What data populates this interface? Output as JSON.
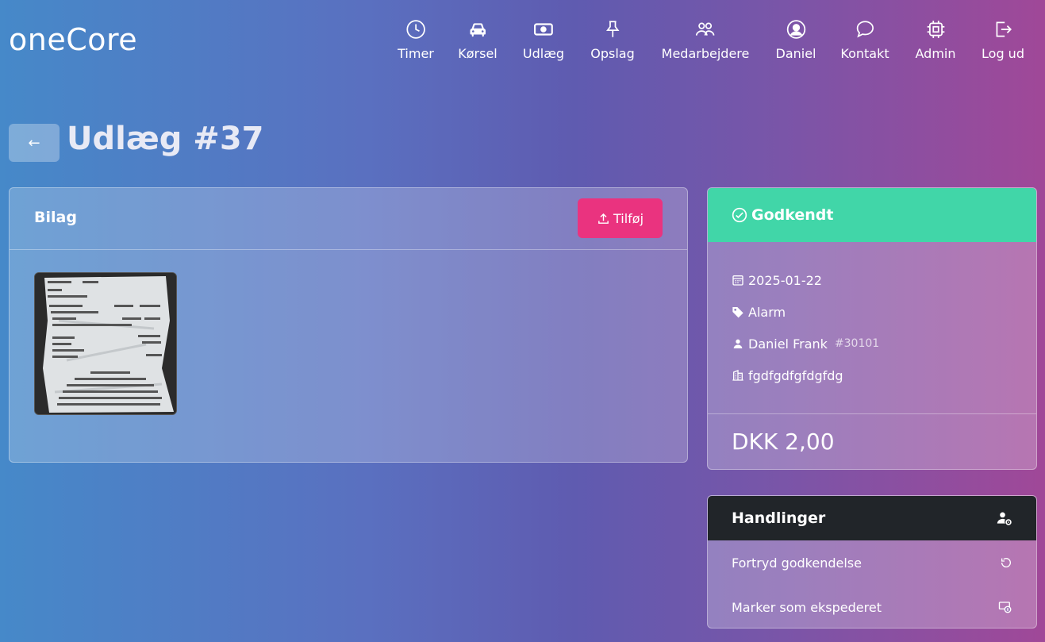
{
  "app": {
    "logo": "oneCore"
  },
  "nav": [
    {
      "label": "Timer",
      "icon": "clock-icon"
    },
    {
      "label": "Kørsel",
      "icon": "car-icon"
    },
    {
      "label": "Udlæg",
      "icon": "cash-icon"
    },
    {
      "label": "Opslag",
      "icon": "pin-icon"
    },
    {
      "label": "Medarbejdere",
      "icon": "people-icon"
    },
    {
      "label": "Daniel",
      "icon": "user-circle-icon"
    },
    {
      "label": "Kontakt",
      "icon": "chat-icon"
    },
    {
      "label": "Admin",
      "icon": "cpu-icon"
    },
    {
      "label": "Log ud",
      "icon": "logout-icon"
    }
  ],
  "page": {
    "back_label": "←",
    "title": "Udlæg #37"
  },
  "bilag": {
    "title": "Bilag",
    "add_label": "Tilføj"
  },
  "status": {
    "label": "Godkendt",
    "color": "#41d6a8",
    "date": "2025-01-22",
    "category": "Alarm",
    "employee_name": "Daniel Frank",
    "employee_id": "#30101",
    "description": "fgdfgdfgfdgfdg",
    "amount": "DKK 2,00"
  },
  "actions": {
    "title": "Handlinger",
    "items": [
      {
        "label": "Fortryd godkendelse",
        "icon": "undo-icon"
      },
      {
        "label": "Marker som ekspederet",
        "icon": "cash-coin-icon"
      }
    ]
  },
  "colors": {
    "accent_button": "#ea337f",
    "dark_header": "#212529"
  }
}
